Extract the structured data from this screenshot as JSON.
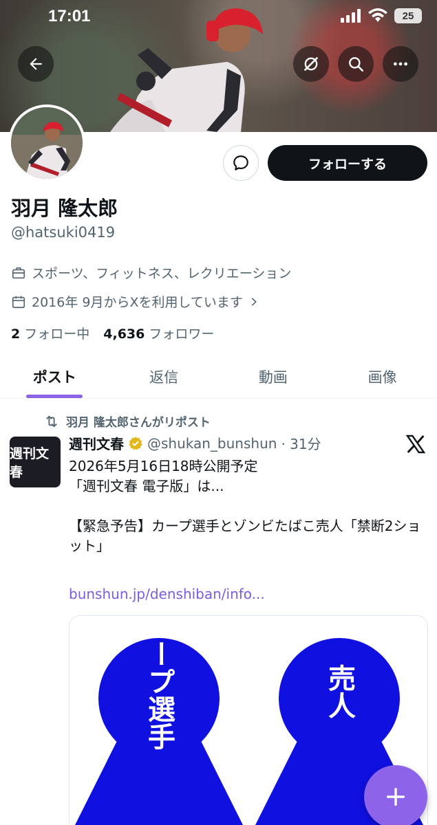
{
  "status_bar": {
    "time": "17:01",
    "battery": "25"
  },
  "icons": {
    "back": "arrow-left-icon",
    "grok": "grok-icon",
    "search": "search-icon",
    "more": "more-icon",
    "message": "message-icon",
    "briefcase": "briefcase-icon",
    "calendar": "calendar-icon",
    "repost": "repost-icon",
    "verified": "verified-badge-icon",
    "x_logo": "x-logo-icon",
    "compose": "plus-icon"
  },
  "profile": {
    "display_name": "羽月 隆太郎",
    "handle": "@hatsuki0419",
    "category": "スポーツ、フィットネス、レクリエーション",
    "joined": "2016年 9月からXを利用しています",
    "following_count": "2",
    "following_label": "フォロー中",
    "followers_count": "4,636",
    "followers_label": "フォロワー",
    "follow_button": "フォローする"
  },
  "tabs": [
    {
      "label": "ポスト",
      "active": true
    },
    {
      "label": "返信",
      "active": false
    },
    {
      "label": "動画",
      "active": false
    },
    {
      "label": "画像",
      "active": false
    }
  ],
  "post": {
    "repost_text": "羽月 隆太郎さんがリポスト",
    "avatar_text": "週刊文春",
    "author": "週刊文春",
    "handle": "@shukan_bunshun",
    "time": "· 31分",
    "text_lines": [
      "2026年5月16日18時公開予定",
      "「週刊文春 電子版」は...",
      "",
      "【緊急予告】カープ選手とゾンビたばこ売人「禁断2ショット」"
    ],
    "link": "bunshun.jp/denshiban/info...",
    "media_labels": [
      "カープ選手",
      "売人"
    ]
  },
  "colors": {
    "accent": "#8d63ea",
    "link": "#7b5ce0",
    "media_blue": "#1010e0",
    "verified_gold": "#e2b719"
  }
}
